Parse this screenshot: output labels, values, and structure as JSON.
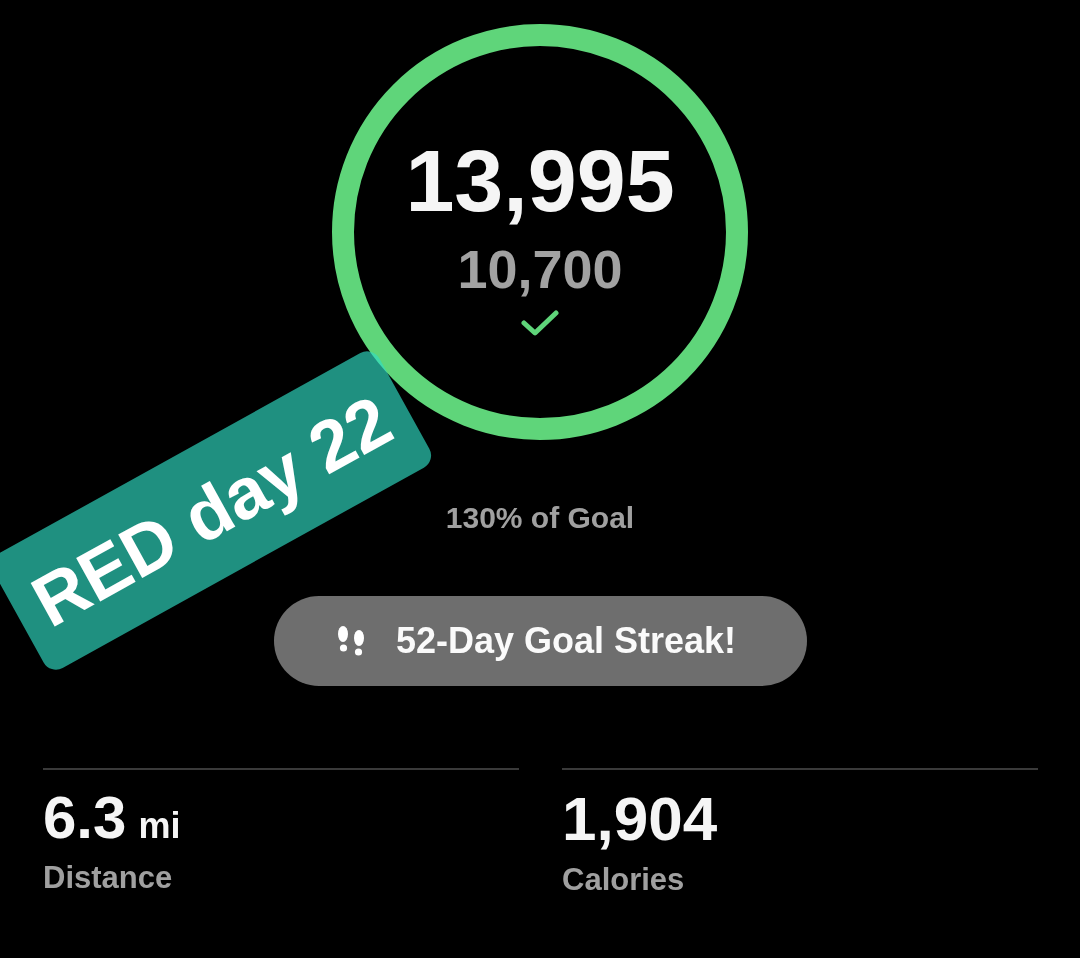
{
  "steps": {
    "count": "13,995",
    "goal": "10,700",
    "goal_met": true,
    "level": 1
  },
  "goal_percent": "130% of Goal",
  "streak": {
    "label": "52-Day Goal Streak!"
  },
  "stats": [
    {
      "value": "6.3",
      "unit": "mi",
      "label": "Distance"
    },
    {
      "value": "1,904",
      "label": "Calories"
    }
  ],
  "sticker": {
    "text": "RED day 22"
  }
}
